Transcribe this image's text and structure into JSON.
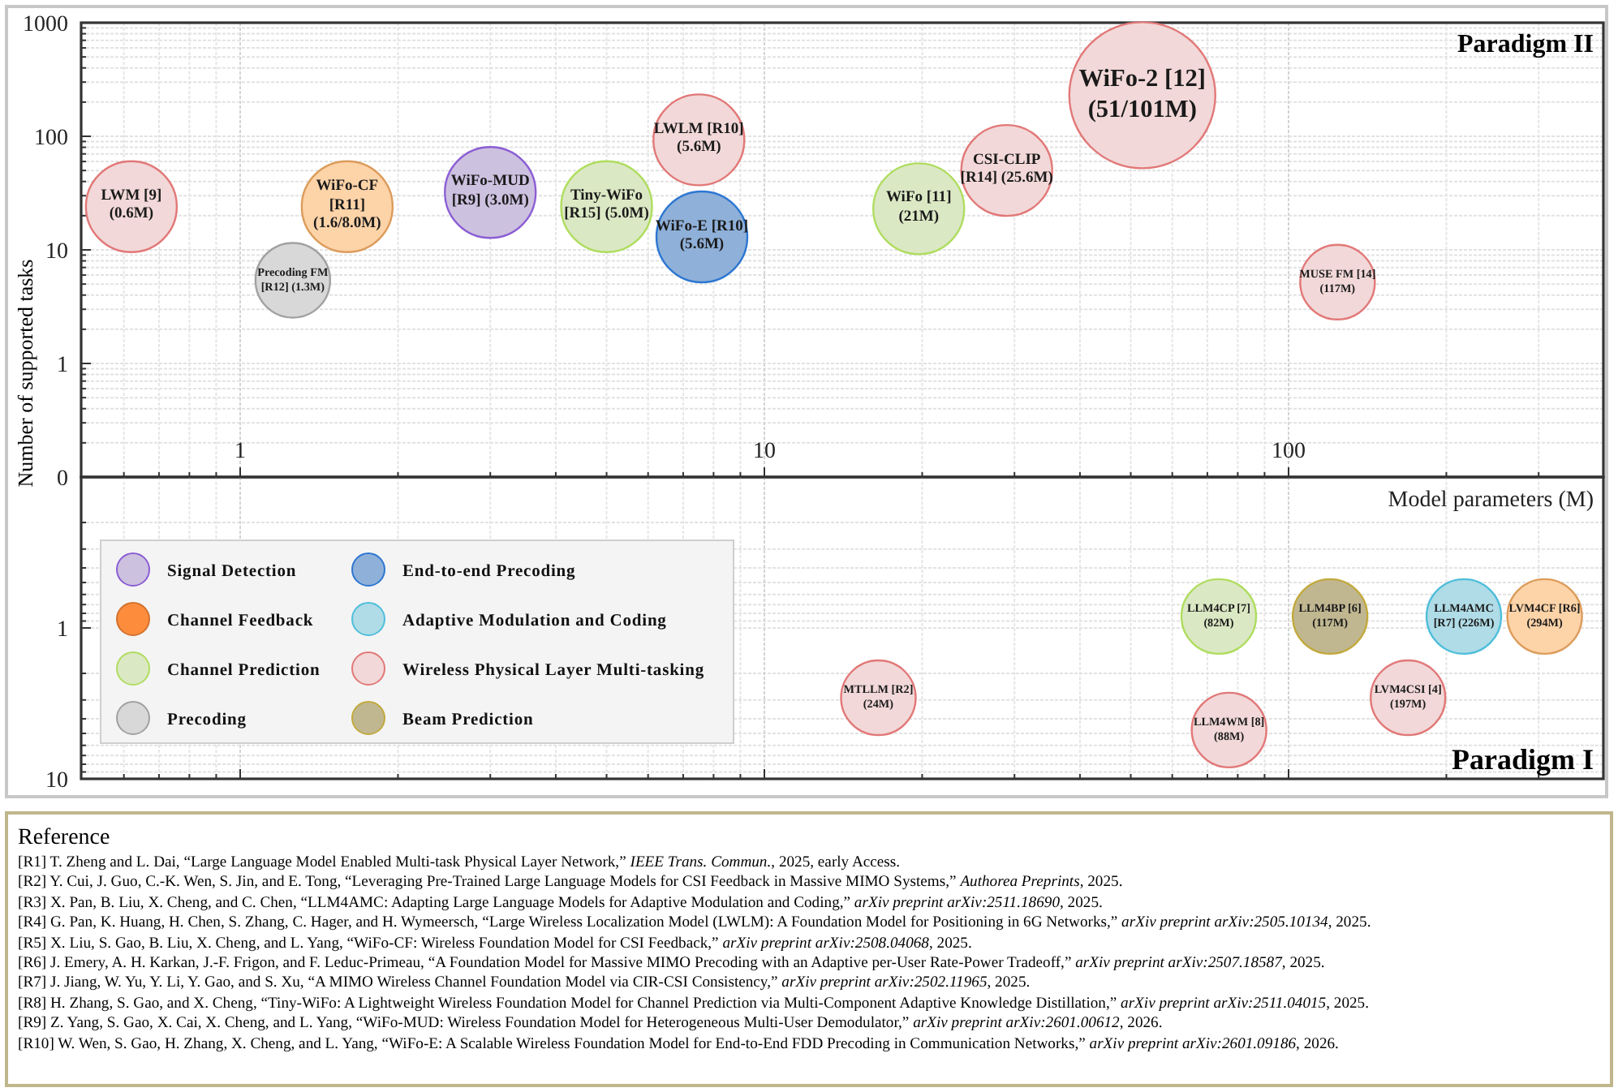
{
  "figure": {
    "y_axis_title": "Number of supported tasks",
    "x_axis_title": "Model parameters (M)",
    "x_tick_labels": [
      "1",
      "10",
      "100"
    ],
    "panels": [
      {
        "title": "Paradigm II",
        "y_tick_labels": [
          "1000",
          "100",
          "10",
          "1",
          "0"
        ],
        "bubbles": [
          {
            "name": "LWM [9] (0.6M)",
            "color": "#f2d8d8"
          },
          {
            "name": "Precoding FM [R12] (1.3M)",
            "color": "#d8d8d8"
          },
          {
            "name": "WiFo-CF [R11] (1.6/8.0M)",
            "color": "#fdd3a8"
          },
          {
            "name": "WiFo-MUD [R9] (3.0M)",
            "color": "#cdc1e0"
          },
          {
            "name": "Tiny-WiFo [R15] (5.0M)",
            "color": "#dbe8c4"
          },
          {
            "name": "LWLM [R10] (5.6M)",
            "color": "#f2d8d8"
          },
          {
            "name": "WiFo-E [R10] (5.6M)",
            "color": "#8fb0d8"
          },
          {
            "name": "WiFo [11] (21M)",
            "color": "#dbe8c4"
          },
          {
            "name": "CSI-CLIP [R14] (25.6M)",
            "color": "#f2d8d8"
          },
          {
            "name": "WiFo-2 [12] (51/101M)",
            "color": "#f2d8d8"
          },
          {
            "name": "MUSE FM [14] (117M)",
            "color": "#f2d8d8"
          }
        ]
      },
      {
        "title": "Paradigm I",
        "y_tick_labels": [
          "1",
          "10"
        ],
        "bubbles": [
          {
            "name": "MTLLM [R2] (24M)",
            "color": "#f2d8d8"
          },
          {
            "name": "LLM4CP [7] (82M)",
            "color": "#dbe8c4"
          },
          {
            "name": "LLM4WM [8] (88M)",
            "color": "#f2d8d8"
          },
          {
            "name": "LLM4BP [6] (117M)",
            "color": "#c0b791"
          },
          {
            "name": "LVM4CSI [4] (197M)",
            "color": "#f2d8d8"
          },
          {
            "name": "LLM4AMC [R7] (226M)",
            "color": "#b0dce7"
          },
          {
            "name": "LVM4CF [R6] (294M)",
            "color": "#fdd3a8"
          }
        ]
      }
    ],
    "legend": [
      {
        "label": "Signal Detection",
        "color": "#cdc1e0"
      },
      {
        "label": "Channel Feedback",
        "color": "#fd8d3c"
      },
      {
        "label": "Channel Prediction",
        "color": "#dbe8c4"
      },
      {
        "label": "Precoding",
        "color": "#d8d8d8"
      },
      {
        "label": "End-to-end Precoding",
        "color": "#8fb0d8"
      },
      {
        "label": "Adaptive Modulation and Coding",
        "color": "#b0dce7"
      },
      {
        "label": "Wireless Physical Layer Multi-tasking",
        "color": "#f2d8d8"
      },
      {
        "label": "Beam Prediction",
        "color": "#c0b791"
      }
    ]
  },
  "references": {
    "title": "Reference",
    "items": [
      "[R1] T. Zheng and L. Dai, “Large Language Model Enabled Multi-task Physical Layer Network,” *IEEE Trans. Commun.*, 2025, early Access.",
      "[R2] Y. Cui, J. Guo, C.-K. Wen, S. Jin, and E. Tong, “Leveraging Pre-Trained Large Language Models for CSI Feedback in Massive MIMO Systems,” *Authorea Preprints*, 2025.",
      "[R3] X. Pan, B. Liu, X. Cheng, and C. Chen, “LLM4AMC: Adapting Large Language Models for Adaptive Modulation and Coding,” *arXiv preprint arXiv:2511.18690*, 2025.",
      "[R4] G. Pan, K. Huang, H. Chen, S. Zhang, C. Hager, and H. Wymeersch, “Large Wireless Localization Model (LWLM): A Foundation Model for Positioning in 6G Networks,” *arXiv preprint arXiv:2505.10134*, 2025.",
      "[R5] X. Liu, S. Gao, B. Liu, X. Cheng, and L. Yang, “WiFo-CF: Wireless Foundation Model for CSI Feedback,” *arXiv preprint arXiv:2508.04068*, 2025.",
      "[R6] J. Emery, A. H. Karkan, J.-F. Frigon, and F. Leduc-Primeau, “A Foundation Model for Massive MIMO Precoding with an Adaptive per-User Rate-Power Tradeoff,” *arXiv preprint arXiv:2507.18587*, 2025.",
      "[R7] J. Jiang, W. Yu, Y. Li, Y. Gao, and S. Xu, “A MIMO Wireless Channel Foundation Model via CIR-CSI Consistency,” *arXiv preprint arXiv:2502.11965*, 2025.",
      "[R8] H. Zhang, S. Gao, and X. Cheng, “Tiny-WiFo: A Lightweight Wireless Foundation Model for Channel Prediction via Multi-Component Adaptive Knowledge Distillation,” *arXiv preprint arXiv:2511.04015*, 2025.",
      "[R9] Z. Yang, S. Gao, X. Cai, X. Cheng, and L. Yang, “WiFo-MUD: Wireless Foundation Model for Heterogeneous Multi-User Demodulator,” *arXiv preprint arXiv:2601.00612*, 2026.",
      "[R10] W. Wen, S. Gao, H. Zhang, X. Cheng, and L. Yang, “WiFo-E: A Scalable Wireless Foundation Model for End-to-End FDD Precoding in Communication Networks,” *arXiv preprint arXiv:2601.09186*, 2026."
    ]
  }
}
